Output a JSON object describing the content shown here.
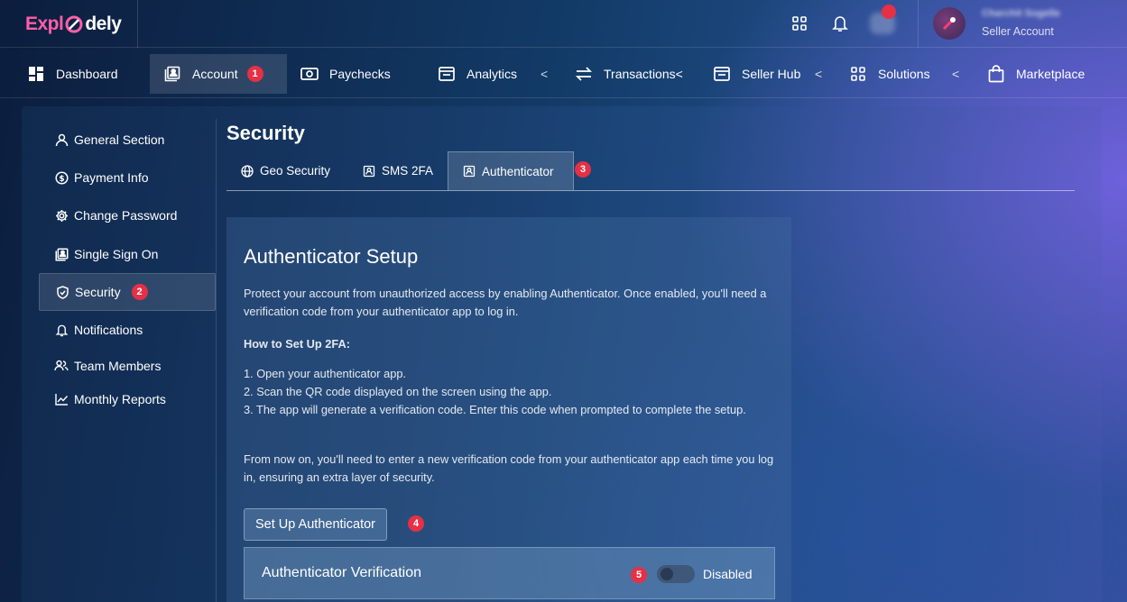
{
  "brand": {
    "logo_left": "Expl",
    "logo_right": "dely"
  },
  "topbar": {
    "icons": [
      "grid-icon",
      "bell-icon",
      "message-icon"
    ],
    "user": {
      "name": "Charchit Sogelle",
      "role": "Seller Account"
    }
  },
  "nav": {
    "items": [
      {
        "label": "Dashboard",
        "icon": "dashboard-icon"
      },
      {
        "label": "Account",
        "icon": "account-icon",
        "badge": "1",
        "active": true
      },
      {
        "label": "Paychecks",
        "icon": "camera-icon"
      },
      {
        "label": "Analytics",
        "icon": "browser-icon"
      },
      {
        "label": "Transactions",
        "icon": "arrows-icon"
      },
      {
        "label": "Seller Hub",
        "icon": "browser-icon"
      },
      {
        "label": "Solutions",
        "icon": "grid-icon"
      },
      {
        "label": "Marketplace",
        "icon": "bag-icon"
      }
    ],
    "chevron": "<"
  },
  "sidebar": {
    "items": [
      {
        "label": "General Section",
        "icon": "user-icon"
      },
      {
        "label": "Payment Info",
        "icon": "dollar-icon"
      },
      {
        "label": "Change Password",
        "icon": "gear-icon"
      },
      {
        "label": "Single Sign On",
        "icon": "account-icon"
      },
      {
        "label": "Security",
        "icon": "shield-icon",
        "badge": "2",
        "active": true
      },
      {
        "label": "Notifications",
        "icon": "bell-icon"
      },
      {
        "label": "Team Members",
        "icon": "team-icon"
      },
      {
        "label": "Monthly Reports",
        "icon": "chart-icon"
      }
    ]
  },
  "page": {
    "title": "Security",
    "tabs": [
      {
        "label": "Geo Security",
        "icon": "globe-icon"
      },
      {
        "label": "SMS 2FA",
        "icon": "account-icon"
      },
      {
        "label": "Authenticator",
        "icon": "account-icon",
        "badge": "3",
        "active": true
      }
    ]
  },
  "card": {
    "title": "Authenticator Setup",
    "intro": "Protect your account from unauthorized access by enabling Authenticator. Once enabled, you'll need a verification code from your authenticator app to log in.",
    "howto_title": "How to Set Up 2FA:",
    "steps": [
      "1. Open your authenticator app.",
      "2. Scan the QR code displayed on the screen using the app.",
      "3. The app will generate a verification code. Enter this code when prompted to complete the setup."
    ],
    "outro": "From now on, you'll need to enter a new verification code from your authenticator app each time you log in, ensuring an extra layer of security.",
    "button_label": "Set Up Authenticator",
    "button_badge": "4",
    "verification": {
      "label": "Authenticator Verification",
      "badge": "5",
      "state": "Disabled",
      "enabled": false
    }
  },
  "colors": {
    "badge": "#e53045",
    "logo_accent": "#ff5fa8"
  }
}
